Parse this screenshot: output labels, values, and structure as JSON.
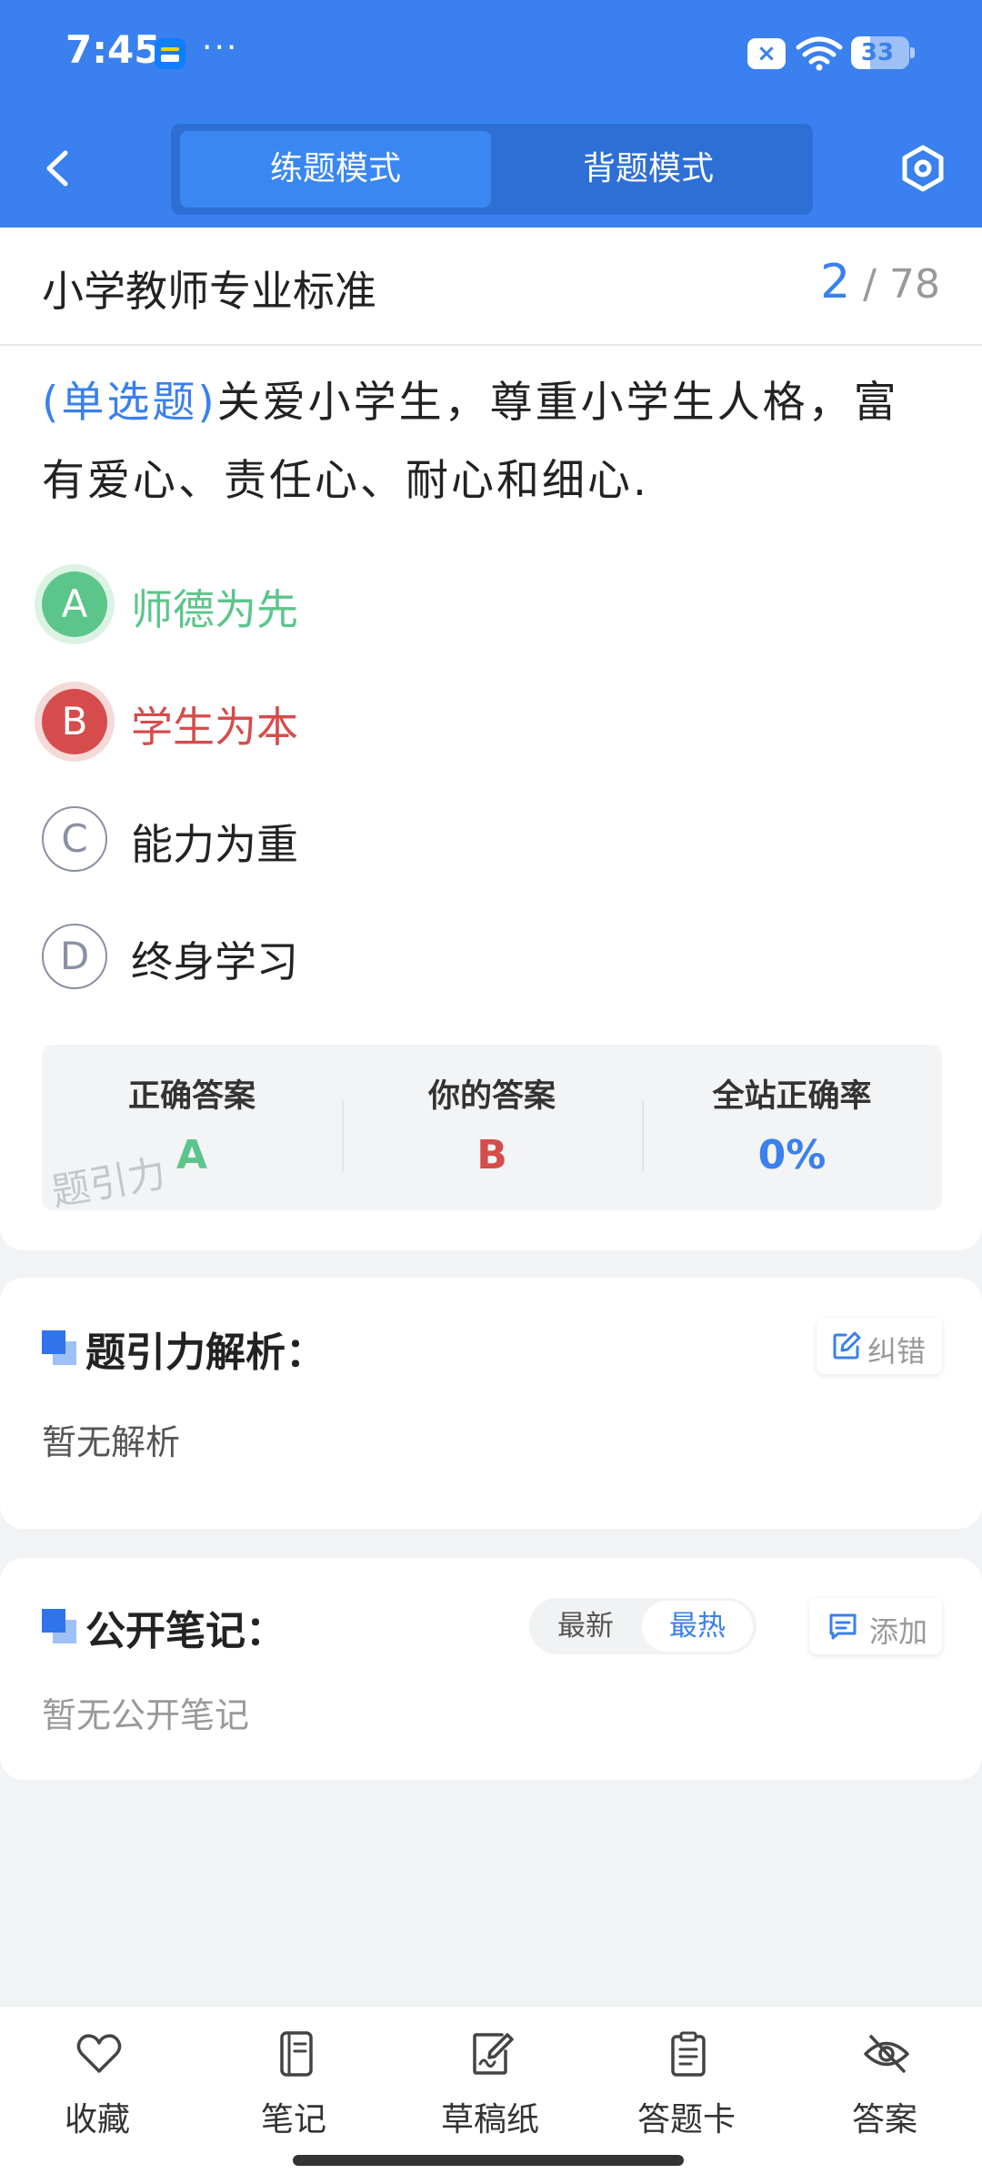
{
  "status_bar": {
    "time": "7:45",
    "dots": "···",
    "sim_label": "×",
    "battery_percent": 33,
    "battery_label": "33"
  },
  "header": {
    "tabs": [
      {
        "label": "练题模式",
        "active": true
      },
      {
        "label": "背题模式",
        "active": false
      }
    ],
    "accent_color": "#3a80ee"
  },
  "subject": {
    "title": "小学教师专业标准",
    "current": "2",
    "separator": "/",
    "total": "78"
  },
  "question": {
    "type": "(单选题)",
    "text": "关爱小学生，尊重小学生人格，富有爱心、责任心、耐心和细心."
  },
  "options": [
    {
      "letter": "A",
      "text": "师德为先",
      "state": "correct"
    },
    {
      "letter": "B",
      "text": "学生为本",
      "state": "wrong"
    },
    {
      "letter": "C",
      "text": "能力为重",
      "state": "normal"
    },
    {
      "letter": "D",
      "text": "终身学习",
      "state": "normal"
    }
  ],
  "answer_summary": {
    "correct_label": "正确答案",
    "correct_value": "A",
    "yours_label": "你的答案",
    "yours_value": "B",
    "rate_label": "全站正确率",
    "rate_value": "0%",
    "watermark": "题引力"
  },
  "analysis": {
    "title": "题引力解析：",
    "fix_label": "纠错",
    "empty": "暂无解析"
  },
  "notes": {
    "title": "公开笔记：",
    "sort_latest": "最新",
    "sort_hot": "最热",
    "add_label": "添加",
    "empty": "暂无公开笔记"
  },
  "bottom_nav": [
    {
      "label": "收藏",
      "icon": "heart-icon"
    },
    {
      "label": "笔记",
      "icon": "notebook-icon"
    },
    {
      "label": "草稿纸",
      "icon": "draft-icon"
    },
    {
      "label": "答题卡",
      "icon": "answer-card-icon"
    },
    {
      "label": "答案",
      "icon": "eye-off-icon"
    }
  ]
}
